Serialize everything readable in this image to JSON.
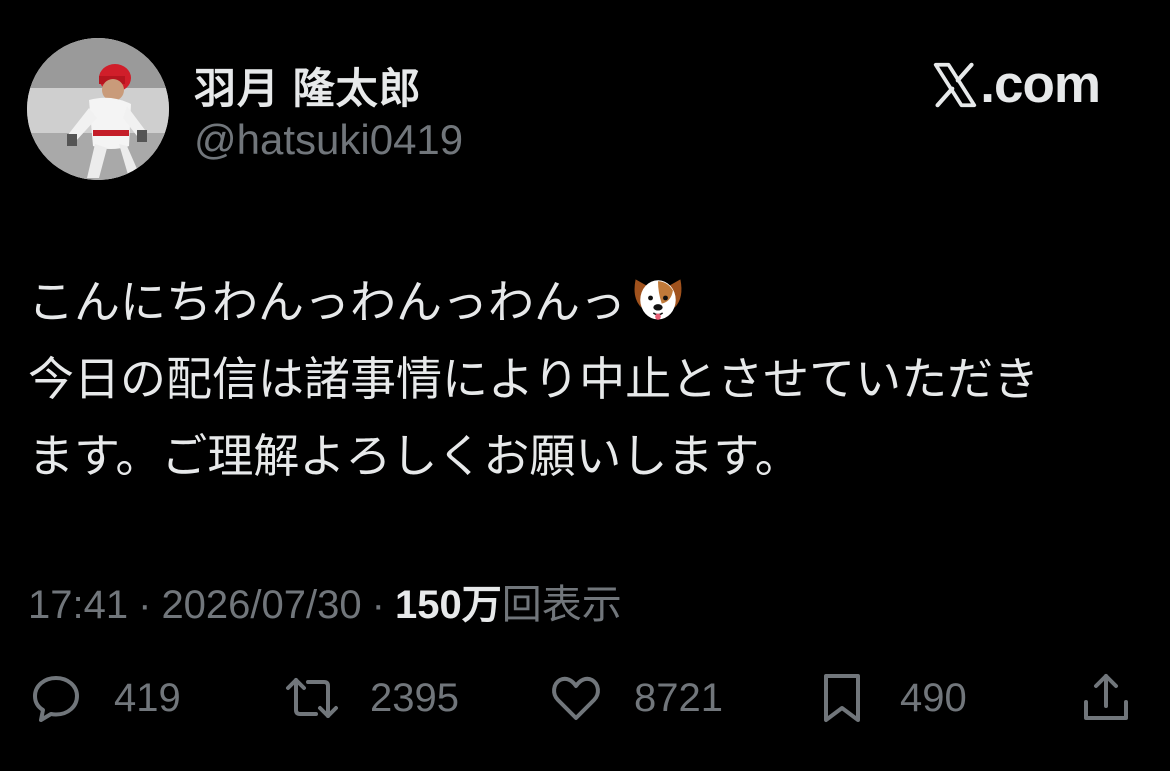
{
  "author": {
    "display_name": "羽月 隆太郎",
    "handle": "@hatsuki0419"
  },
  "brand": {
    "label": ".com",
    "icon": "x-logo-icon"
  },
  "tweet": {
    "lines": [
      "こんにちわんっわんっわんっ",
      "今日の配信は諸事情により中止とさせていただき",
      "ます。ご理解よろしくお願いします。"
    ],
    "emoji": "dog-face-icon"
  },
  "meta": {
    "time": "17:41",
    "separator": "·",
    "date": "2026/07/30",
    "views_count": "150万",
    "views_label": "回表示"
  },
  "actions": {
    "reply_count": "419",
    "retweet_count": "2395",
    "like_count": "8721",
    "bookmark_count": "490"
  },
  "colors": {
    "background": "#000000",
    "text_primary": "#e7e9ea",
    "text_secondary": "#71767b"
  }
}
